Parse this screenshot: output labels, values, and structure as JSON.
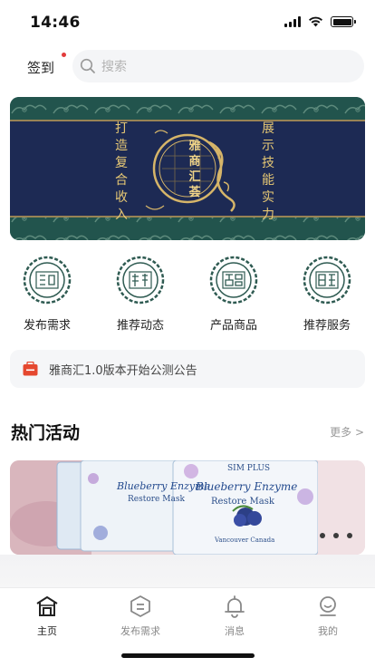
{
  "status_bar": {
    "time": "14:46"
  },
  "header": {
    "checkin_label": "签到",
    "search_placeholder": "搜索"
  },
  "banner": {
    "left_text": [
      "打",
      "造",
      "复",
      "合",
      "收",
      "入"
    ],
    "center_text": [
      "雅",
      "商",
      "汇",
      "荟"
    ],
    "right_text": [
      "展",
      "示",
      "技",
      "能",
      "实",
      "力"
    ]
  },
  "quick_menu": [
    {
      "label": "发布需求",
      "icon": "seal-publish-icon"
    },
    {
      "label": "推荐动态",
      "icon": "seal-news-icon"
    },
    {
      "label": "产品商品",
      "icon": "seal-product-icon"
    },
    {
      "label": "推荐服务",
      "icon": "seal-service-icon"
    }
  ],
  "notice": {
    "text": "雅商汇1.0版本开始公测公告",
    "icon": "megaphone-icon"
  },
  "hot_section": {
    "title": "热门活动",
    "more_label": "更多 >",
    "card": {
      "brand": "SIM PLUS",
      "product_line_1": "Blueberry Enzyme",
      "product_line_2": "Restore Mask",
      "origin": "Vancouver Canada"
    }
  },
  "tab_bar": [
    {
      "label": "主页",
      "icon": "home-icon",
      "active": true
    },
    {
      "label": "发布需求",
      "icon": "publish-icon",
      "active": false
    },
    {
      "label": "消息",
      "icon": "bell-icon",
      "active": false
    },
    {
      "label": "我的",
      "icon": "profile-icon",
      "active": false
    }
  ],
  "colors": {
    "accent_gold": "#e7c874",
    "banner_green": "#1f4f49",
    "banner_navy": "#1d2a54",
    "seal_green": "#2f5b52",
    "notice_red": "#e5482f"
  }
}
